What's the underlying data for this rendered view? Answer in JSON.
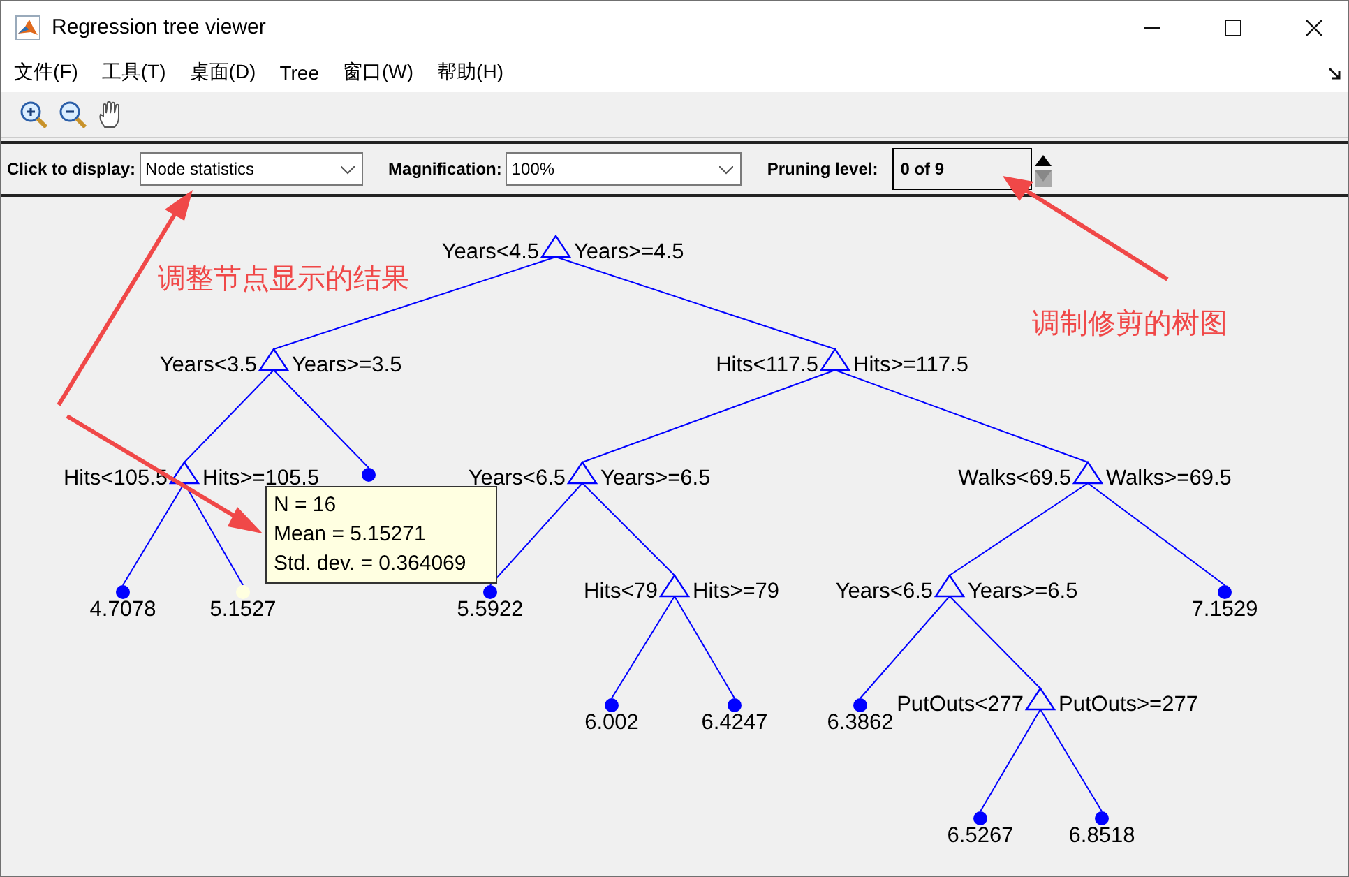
{
  "window": {
    "title": "Regression tree viewer"
  },
  "menu": [
    {
      "label": "文件(F)"
    },
    {
      "label": "工具(T)"
    },
    {
      "label": "桌面(D)"
    },
    {
      "label": "Tree"
    },
    {
      "label": "窗口(W)"
    },
    {
      "label": "帮助(H)"
    }
  ],
  "controls": {
    "display": {
      "label": "Click to display:",
      "value": "Node statistics"
    },
    "magnification": {
      "label": "Magnification:",
      "value": "100%"
    },
    "pruning": {
      "label": "Pruning level:",
      "value": "0 of 9"
    }
  },
  "tree": {
    "left": "Years<4.5",
    "right": "Years>=4.5",
    "children": [
      {
        "left": "Years<3.5",
        "right": "Years>=3.5",
        "children": [
          {
            "left": "Hits<105.5",
            "right": "Hits>=105.5",
            "children": [
              {
                "value": "4.7078",
                "selected": false
              },
              {
                "value": "5.1527",
                "selected": true
              }
            ]
          },
          {
            "selected": false
          }
        ]
      },
      {
        "left": "Hits<117.5",
        "right": "Hits>=117.5",
        "children": [
          {
            "left": "Years<6.5",
            "right": "Years>=6.5",
            "children": [
              {
                "value": "5.5922",
                "selected": false
              },
              {
                "left": "Hits<79",
                "right": "Hits>=79",
                "children": [
                  {
                    "value": "6.002",
                    "selected": false
                  },
                  {
                    "value": "6.4247",
                    "selected": false
                  }
                ]
              }
            ]
          },
          {
            "left": "Walks<69.5",
            "right": "Walks>=69.5",
            "children": [
              {
                "left": "Years<6.5",
                "right": "Years>=6.5",
                "children": [
                  {
                    "value": "6.3862",
                    "selected": false
                  },
                  {
                    "left": "PutOuts<277",
                    "right": "PutOuts>=277",
                    "children": [
                      {
                        "value": "6.5267",
                        "selected": false
                      },
                      {
                        "value": "6.8518",
                        "selected": false
                      }
                    ]
                  }
                ]
              },
              {
                "value": "7.1529",
                "selected": false
              }
            ]
          }
        ]
      }
    ]
  },
  "tooltip": {
    "lines": [
      "N = 16",
      "Mean = 5.15271",
      "Std. dev. = 0.364069"
    ]
  },
  "annotations": [
    {
      "text": "调整节点显示的结果"
    },
    {
      "text": "调制修剪的树图"
    }
  ]
}
